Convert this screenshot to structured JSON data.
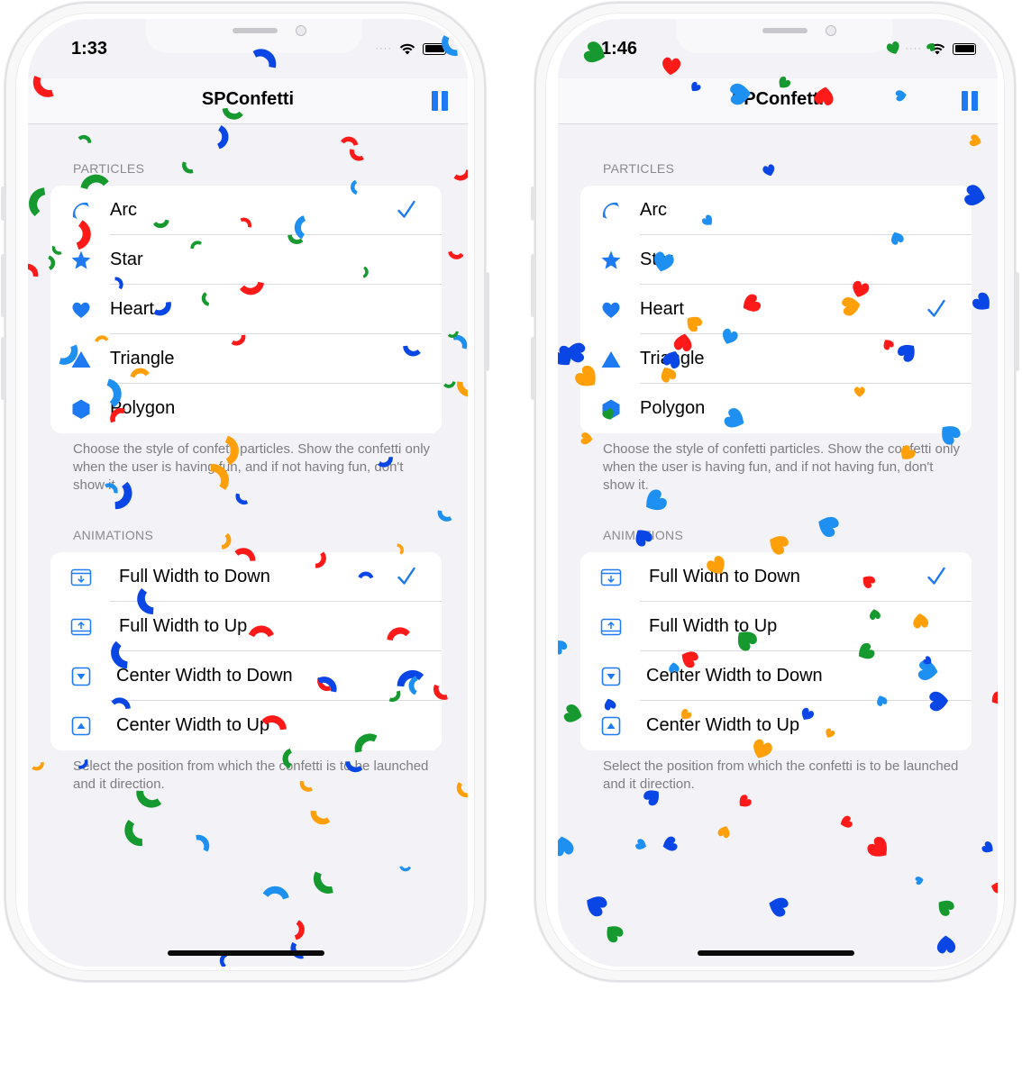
{
  "screens": [
    {
      "status_time": "1:33",
      "title": "SPConfetti",
      "particles_header": "PARTICLES",
      "particles": [
        {
          "label": "Arc",
          "icon": "arc-icon",
          "selected": true
        },
        {
          "label": "Star",
          "icon": "star-icon",
          "selected": false
        },
        {
          "label": "Heart",
          "icon": "heart-icon",
          "selected": false
        },
        {
          "label": "Triangle",
          "icon": "triangle-icon",
          "selected": false
        },
        {
          "label": "Polygon",
          "icon": "polygon-icon",
          "selected": false
        }
      ],
      "particles_footer": "Choose the style of confetti particles. Show the confetti only when the user is having fun, and if not having fun, don't show it.",
      "animations_header": "ANIMATIONS",
      "animations": [
        {
          "label": "Full Width to Down",
          "icon": "full-width-down-icon",
          "selected": true
        },
        {
          "label": "Full Width to Up",
          "icon": "full-width-up-icon",
          "selected": false
        },
        {
          "label": "Center Width to Down",
          "icon": "center-width-down-icon",
          "selected": false
        },
        {
          "label": "Center Width to Up",
          "icon": "center-width-up-icon",
          "selected": false
        }
      ],
      "animations_footer": "Select the position from which the confetti is to be launched and it direction.",
      "confetti_style": "arc"
    },
    {
      "status_time": "1:46",
      "title": "SPConfetti",
      "particles_header": "PARTICLES",
      "particles": [
        {
          "label": "Arc",
          "icon": "arc-icon",
          "selected": false
        },
        {
          "label": "Star",
          "icon": "star-icon",
          "selected": false
        },
        {
          "label": "Heart",
          "icon": "heart-icon",
          "selected": true
        },
        {
          "label": "Triangle",
          "icon": "triangle-icon",
          "selected": false
        },
        {
          "label": "Polygon",
          "icon": "polygon-icon",
          "selected": false
        }
      ],
      "particles_footer": "Choose the style of confetti particles. Show the confetti only when the user is having fun, and if not having fun, don't show it.",
      "animations_header": "ANIMATIONS",
      "animations": [
        {
          "label": "Full Width to Down",
          "icon": "full-width-down-icon",
          "selected": true
        },
        {
          "label": "Full Width to Up",
          "icon": "full-width-up-icon",
          "selected": false
        },
        {
          "label": "Center Width to Down",
          "icon": "center-width-down-icon",
          "selected": false
        },
        {
          "label": "Center Width to Up",
          "icon": "center-width-up-icon",
          "selected": false
        }
      ],
      "animations_footer": "Select the position from which the confetti is to be launched and it direction.",
      "confetti_style": "heart"
    }
  ],
  "colors": {
    "accent": "#1d7af3",
    "confetti": [
      "#ff1a1a",
      "#0a45e6",
      "#ffa00a",
      "#16992e",
      "#1e90f2"
    ]
  }
}
